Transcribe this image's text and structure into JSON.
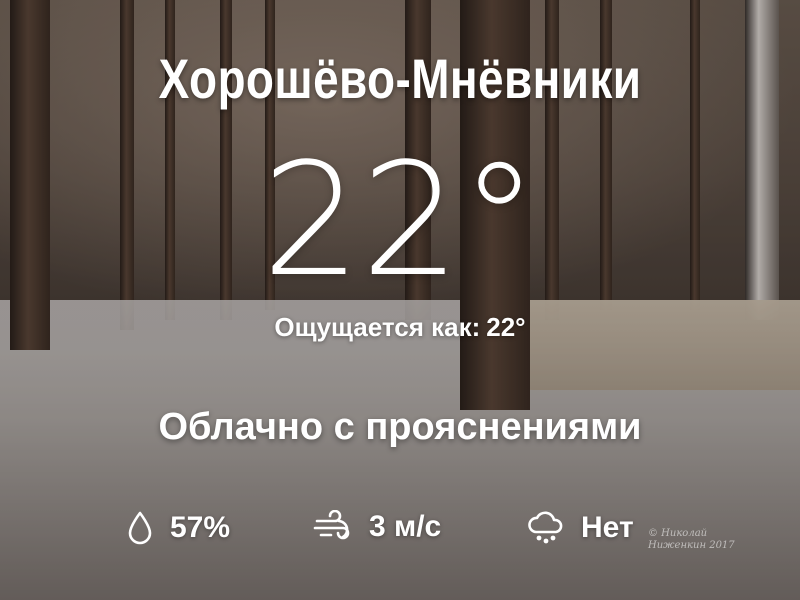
{
  "location": "Хорошёво-Мнёвники",
  "temperature": "22°",
  "feels_like": {
    "label": "Ощущается как:",
    "value": "22°"
  },
  "condition": "Облачно с прояснениями",
  "stats": {
    "humidity": {
      "icon": "droplet-icon",
      "value": "57%"
    },
    "wind": {
      "icon": "wind-icon",
      "value": "3 м/с"
    },
    "precipitation": {
      "icon": "rain-cloud-icon",
      "value": "Нет"
    }
  },
  "watermark": {
    "line1": "© Николай",
    "line2": "Ниженкин 2017"
  },
  "colors": {
    "text": "#ffffff",
    "path": "#c9b9a3"
  }
}
